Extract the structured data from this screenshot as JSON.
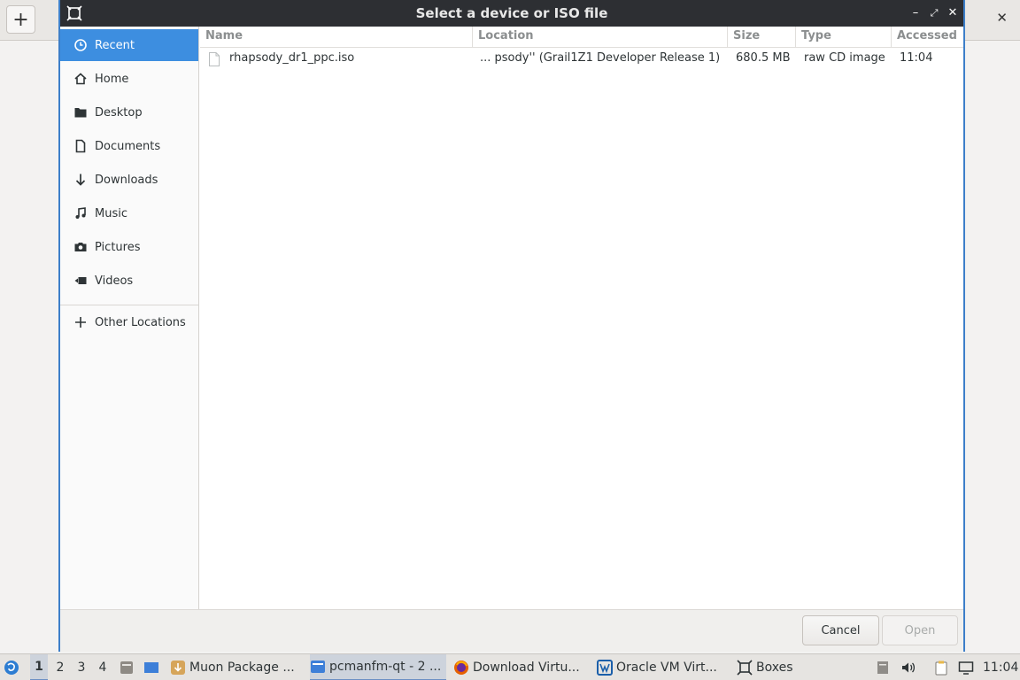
{
  "background_app": {
    "add_button": "+",
    "close_button": "✕"
  },
  "dialog": {
    "title": "Select a device or ISO file",
    "window_controls": {
      "minimize": "–",
      "maximize": "⤢",
      "close": "✕"
    },
    "sidebar": {
      "items": [
        {
          "label": "Recent",
          "icon": "clock-icon",
          "active": true
        },
        {
          "label": "Home",
          "icon": "home-icon"
        },
        {
          "label": "Desktop",
          "icon": "folder-icon"
        },
        {
          "label": "Documents",
          "icon": "document-icon"
        },
        {
          "label": "Downloads",
          "icon": "download-arrow-icon"
        },
        {
          "label": "Music",
          "icon": "music-note-icon"
        },
        {
          "label": "Pictures",
          "icon": "camera-icon"
        },
        {
          "label": "Videos",
          "icon": "video-camera-icon"
        }
      ],
      "other_locations": {
        "label": "Other Locations",
        "icon": "plus-icon"
      }
    },
    "file_list": {
      "columns": [
        "Name",
        "Location",
        "Size",
        "Type",
        "Accessed"
      ],
      "rows": [
        {
          "name": "rhapsody_dr1_ppc.iso",
          "location": "... psody'' (Grail1Z1 Developer Release 1)",
          "size": "680.5 MB",
          "type": "raw CD image",
          "accessed": "11:04"
        }
      ]
    },
    "buttons": {
      "cancel": "Cancel",
      "open": "Open"
    }
  },
  "taskbar": {
    "workspaces": [
      "1",
      "2",
      "3",
      "4"
    ],
    "tasks": [
      {
        "label": "Muon Package ...",
        "icon": "package-icon"
      },
      {
        "label": "pcmanfm-qt - 2 ...",
        "icon": "file-manager-icon",
        "active": true
      },
      {
        "label": "Download Virtu...",
        "icon": "firefox-icon"
      },
      {
        "label": "Oracle VM Virt...",
        "icon": "virtualbox-icon"
      },
      {
        "label": "Boxes",
        "icon": "boxes-icon"
      }
    ],
    "clock": "11:04"
  }
}
